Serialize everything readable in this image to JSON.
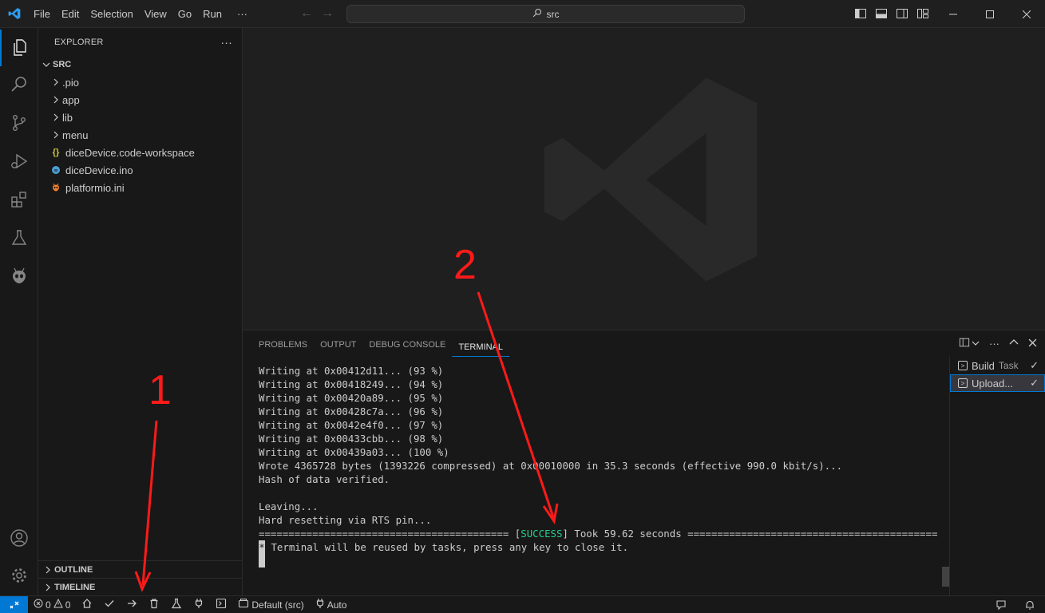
{
  "menu": [
    "File",
    "Edit",
    "Selection",
    "View",
    "Go",
    "Run",
    "···"
  ],
  "command_center": {
    "text": "src"
  },
  "sidebar": {
    "title": "EXPLORER",
    "more": "···",
    "root": "SRC",
    "items": [
      {
        "label": ".pio",
        "type": "folder"
      },
      {
        "label": "app",
        "type": "folder"
      },
      {
        "label": "lib",
        "type": "folder"
      },
      {
        "label": "menu",
        "type": "folder"
      },
      {
        "label": "diceDevice.code-workspace",
        "type": "workspace"
      },
      {
        "label": "diceDevice.ino",
        "type": "ino"
      },
      {
        "label": "platformio.ini",
        "type": "ini"
      }
    ],
    "outline": "OUTLINE",
    "timeline": "TIMELINE"
  },
  "panel": {
    "tabs": [
      "PROBLEMS",
      "OUTPUT",
      "DEBUG CONSOLE",
      "TERMINAL"
    ],
    "active_tab": "TERMINAL",
    "terminal_lines": [
      "Writing at 0x00412d11... (93 %)",
      "Writing at 0x00418249... (94 %)",
      "Writing at 0x00420a89... (95 %)",
      "Writing at 0x00428c7a... (96 %)",
      "Writing at 0x0042e4f0... (97 %)",
      "Writing at 0x00433cbb... (98 %)",
      "Writing at 0x00439a03... (100 %)",
      "Wrote 4365728 bytes (1393226 compressed) at 0x00010000 in 35.3 seconds (effective 990.0 kbit/s)...",
      "Hash of data verified.",
      "",
      "Leaving...",
      "Hard resetting via RTS pin..."
    ],
    "result_line": {
      "prefix": "========================================== [",
      "status": "SUCCESS",
      "suffix": "] Took 59.62 seconds =========================================="
    },
    "reuse_marker": "*",
    "reuse_line": " Terminal will be reused by tasks, press any key to close it.",
    "tasks": [
      {
        "label": "Build",
        "desc": "Task",
        "check": "✓"
      },
      {
        "label": "Upload...",
        "desc": "",
        "check": "✓"
      }
    ]
  },
  "statusbar": {
    "errors": "0",
    "warnings": "0",
    "env": "Default (src)",
    "port": "Auto"
  },
  "annotations": {
    "label1": "1",
    "label2": "2",
    "color": "#ff1a1a"
  }
}
